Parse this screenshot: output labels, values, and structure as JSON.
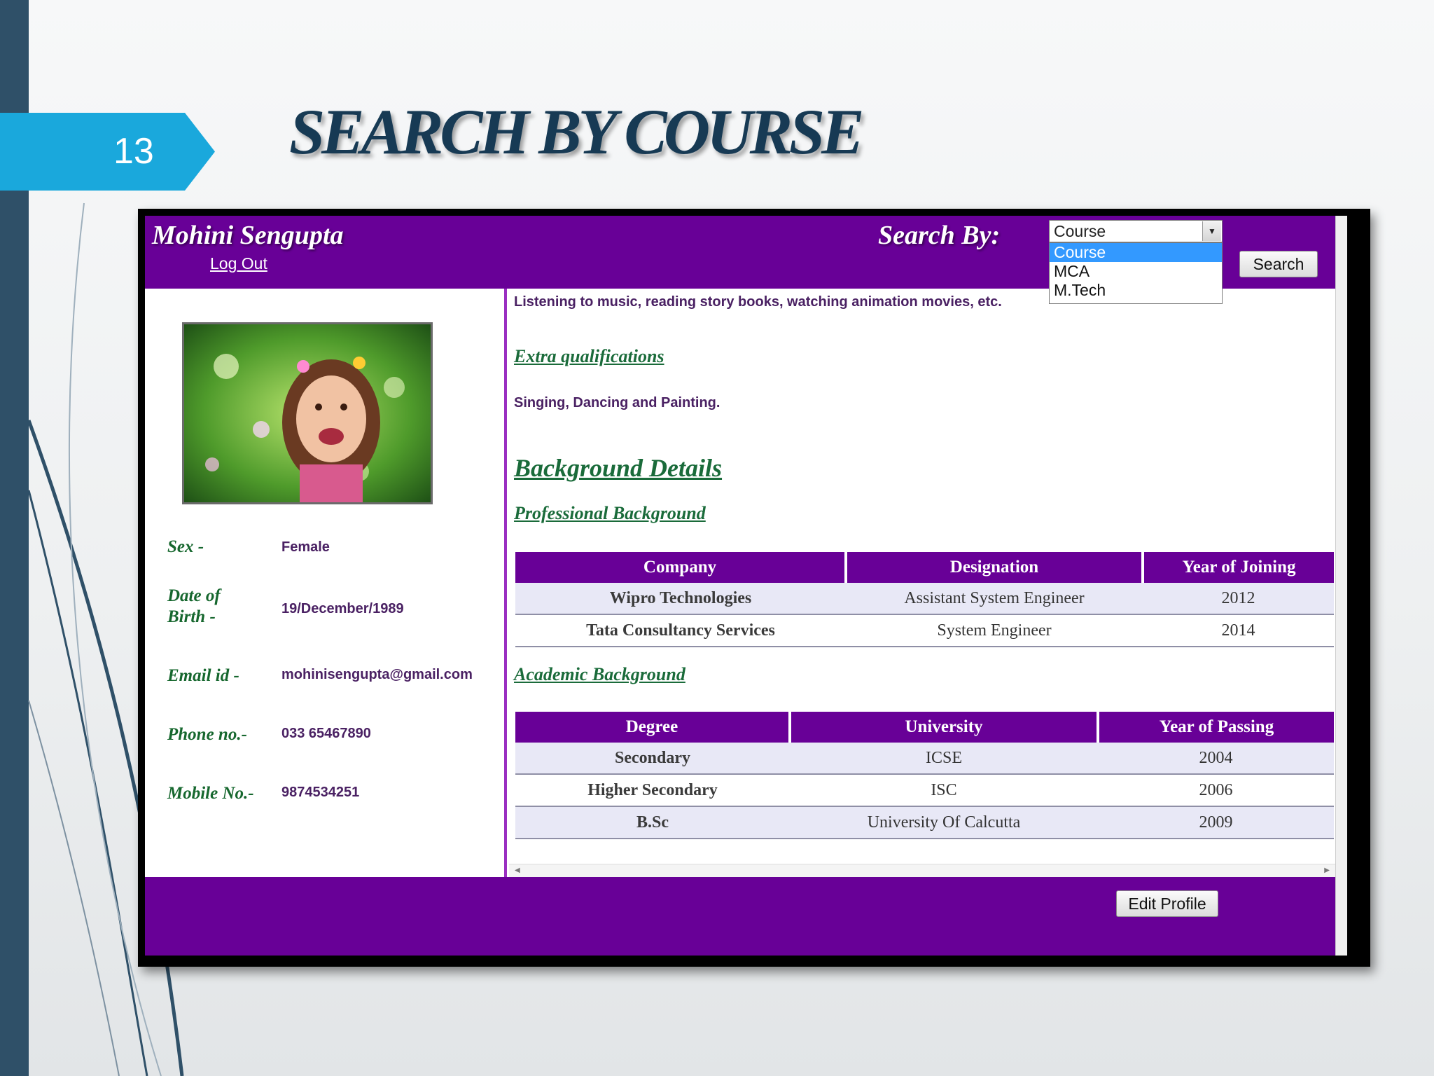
{
  "slide": {
    "number": "13",
    "title": "SEARCH BY COURSE"
  },
  "app": {
    "user_name": "Mohini Sengupta",
    "logout_label": "Log Out",
    "search_by_label": "Search By:",
    "search_select": {
      "value": "Course",
      "options": [
        "Course",
        "MCA",
        "M.Tech"
      ],
      "highlighted": "Course"
    },
    "search_button": "Search",
    "edit_profile_button": "Edit Profile"
  },
  "profile": {
    "sex_label": "Sex -",
    "sex_value": "Female",
    "dob_label_1": "Date of",
    "dob_label_2": "Birth -",
    "dob_value": "19/December/1989",
    "email_label": "Email id -",
    "email_value": "mohinisengupta@gmail.com",
    "phone_label": "Phone no.-",
    "phone_value": "033 65467890",
    "mobile_label": "Mobile No.-",
    "mobile_value": "9874534251"
  },
  "content": {
    "hobbies_text": "Listening to music, reading story books, watching animation movies, etc.",
    "extra_qual_heading": "Extra qualifications",
    "extra_qual_text": "Singing, Dancing and Painting.",
    "background_heading": "Background Details",
    "professional_heading": "Professional Background",
    "professional_table": {
      "headers": [
        "Company",
        "Designation",
        "Year of Joining"
      ],
      "rows": [
        [
          "Wipro Technologies",
          "Assistant System Engineer",
          "2012"
        ],
        [
          "Tata Consultancy Services",
          "System Engineer",
          "2014"
        ]
      ]
    },
    "academic_heading": "Academic Background",
    "academic_table": {
      "headers": [
        "Degree",
        "University",
        "Year of Passing"
      ],
      "rows": [
        [
          "Secondary",
          "ICSE",
          "2004"
        ],
        [
          "Higher Secondary",
          "ISC",
          "2006"
        ],
        [
          "B.Sc",
          "University Of Calcutta",
          "2009"
        ]
      ]
    }
  },
  "colors": {
    "brand_purple": "#680097",
    "slide_accent": "#1aa8dc",
    "heading_green": "#1a6b3a",
    "title_navy": "#173a54"
  }
}
